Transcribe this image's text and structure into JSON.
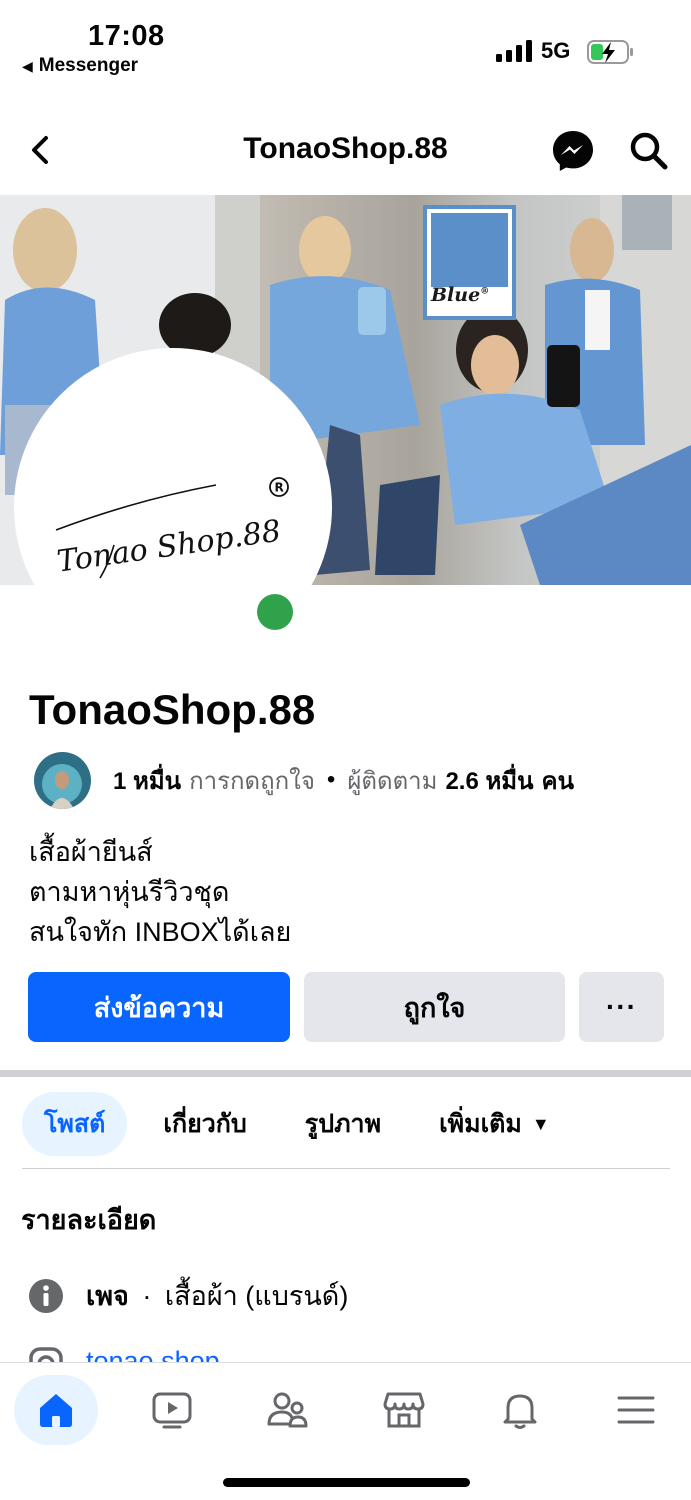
{
  "status_bar": {
    "time": "17:08",
    "back_app": "Messenger",
    "network": "5G",
    "battery_icon": "battery-charging-icon"
  },
  "header": {
    "title": "TonaoShop.88",
    "icons": [
      "back-arrow-icon",
      "messenger-icon",
      "search-icon"
    ]
  },
  "cover": {
    "swatch_label": "Blue",
    "swatch_mark": "®"
  },
  "profile": {
    "logo_text": "TonaoShop.88",
    "logo_mark": "®",
    "online_color": "#31a24c"
  },
  "page": {
    "name": "TonaoShop.88",
    "likes_count": "1 หมื่น",
    "likes_label": "การกดถูกใจ",
    "separator": "•",
    "followers_label": "ผู้ติดตาม",
    "followers_count": "2.6 หมื่น",
    "followers_unit": "คน",
    "bio": [
      "เสื้อผ้ายีนส์",
      "ตามหาหุ่นรีวิวชุด",
      "สนใจทัก INBOXได้เลย"
    ]
  },
  "actions": {
    "message": "ส่งข้อความ",
    "like": "ถูกใจ",
    "more": "···"
  },
  "tabs": {
    "posts": "โพสต์",
    "about": "เกี่ยวกับ",
    "photos": "รูปภาพ",
    "more": "เพิ่มเติม",
    "active": "posts"
  },
  "details": {
    "title": "รายละเอียด",
    "page_label": "เพจ",
    "separator": "·",
    "category": "เสื้อผ้า (แบรนด์)",
    "instagram": "tonao.shop"
  },
  "bottom_nav": {
    "items": [
      "home-icon",
      "video-icon",
      "friends-icon",
      "marketplace-icon",
      "bell-icon",
      "menu-icon"
    ],
    "active": "home"
  },
  "colors": {
    "brand_blue": "#0866ff",
    "light_blue": "#e7f3ff",
    "button_gray": "#e4e6eb",
    "secondary_text": "#65676b"
  }
}
